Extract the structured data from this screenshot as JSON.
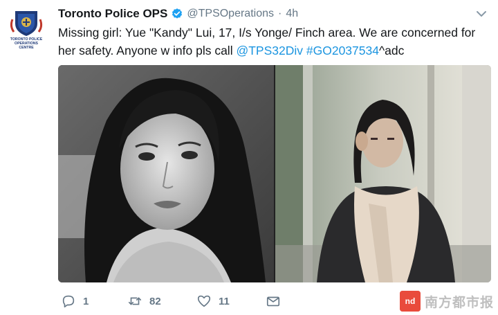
{
  "tweet": {
    "display_name": "Toronto Police OPS",
    "handle": "@TPSOperations",
    "separator": "·",
    "time": "4h",
    "text_before_links": "Missing girl: Yue \"Kandy\" Lui, 17, I/s Yonge/ Finch area. We are concerned for her safety. Anyone w info pls call ",
    "mention": "@TPS32Div",
    "hashtag": "#GO2037534",
    "text_after_links": "^adc",
    "avatar": {
      "icon": "toronto-police-badge-icon",
      "caption_line1": "TORONTO POLICE",
      "caption_line2": "OPERATIONS",
      "caption_line3": "CENTRE"
    },
    "actions": {
      "reply_count": "1",
      "retweet_count": "82",
      "like_count": "11"
    }
  },
  "media": {
    "left_photo": "missing-girl-selfie-photo",
    "right_photo": "missing-girl-cctv-photo"
  },
  "watermark": {
    "logo_text": "nd",
    "text": "南方都市报"
  },
  "colors": {
    "link": "#1b95e0",
    "verified": "#1da1f2",
    "muted": "#657786",
    "watermark_red": "#e94b3c"
  }
}
